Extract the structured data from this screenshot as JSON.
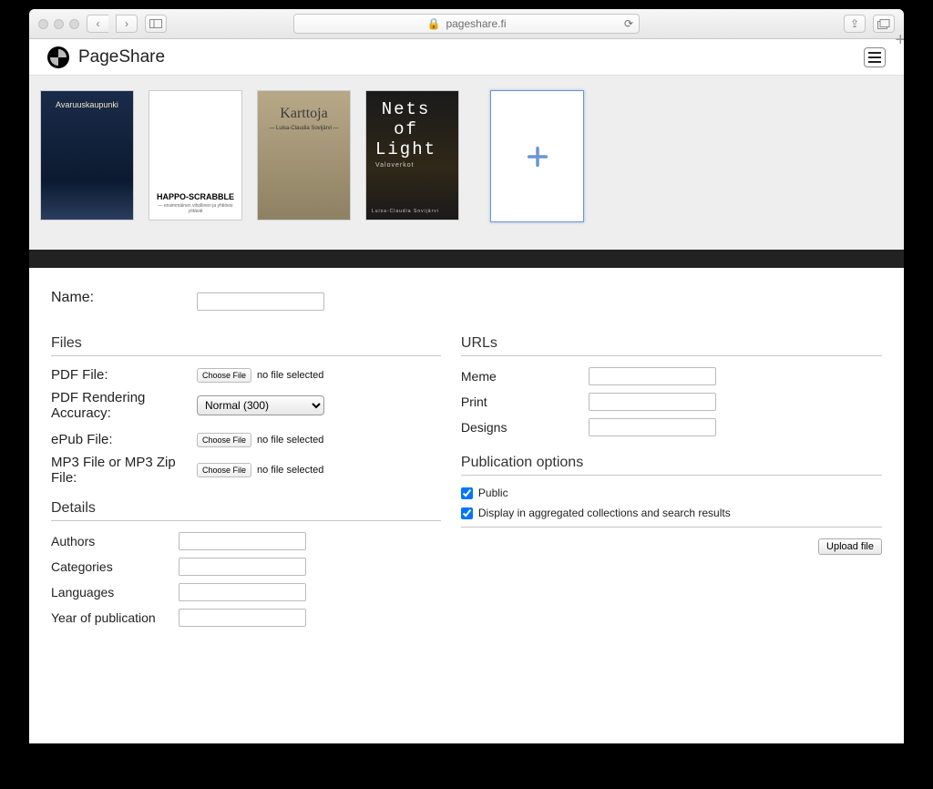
{
  "browser": {
    "url_host": "pageshare.fi",
    "lock": "🔒"
  },
  "header": {
    "brand": "PageShare"
  },
  "books": [
    {
      "title": "Avaruuskaupunki"
    },
    {
      "title": "HAPPO-SCRABBLE",
      "sub": "— ensimmäinen vihollinen ja yhtiöesi yötävät"
    },
    {
      "title": "Karttoja",
      "author": "— Luisa-Claudia Sovijärvi —"
    },
    {
      "title": "Nets\nof\nLight",
      "sub": "Valoverkot",
      "author": "Luisa-Claudia Sovijärvi"
    }
  ],
  "form": {
    "name_label": "Name:",
    "files_title": "Files",
    "pdf_label": "PDF File:",
    "pdf_acc_label": "PDF Rendering Accuracy:",
    "pdf_acc_value": "Normal (300)",
    "epub_label": "ePub File:",
    "mp3_label": "MP3 File or MP3 Zip File:",
    "choose_label": "Choose File",
    "nofile": "no file selected",
    "details_title": "Details",
    "authors_label": "Authors",
    "categories_label": "Categories",
    "languages_label": "Languages",
    "year_label": "Year of publication",
    "urls_title": "URLs",
    "meme_label": "Meme",
    "print_label": "Print",
    "designs_label": "Designs",
    "pubopts_title": "Publication options",
    "public_label": "Public",
    "aggregate_label": "Display in aggregated collections and search results",
    "upload_label": "Upload file",
    "public_checked": true,
    "aggregate_checked": true
  }
}
